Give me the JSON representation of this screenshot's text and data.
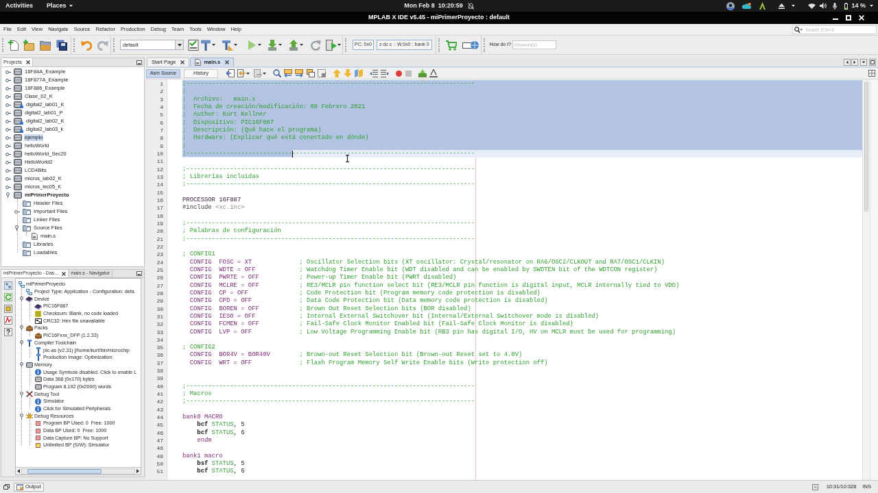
{
  "top_bar": {
    "activities": "Activities",
    "places": "Places",
    "clock": "Mon Feb 8  10:20:59",
    "battery": "14 %"
  },
  "window": {
    "title": "MPLAB X IDE v5.45 - miPrimerProyecto : default"
  },
  "menu": [
    "File",
    "Edit",
    "View",
    "Navigate",
    "Source",
    "Refactor",
    "Production",
    "Debug",
    "Team",
    "Tools",
    "Window",
    "Help"
  ],
  "search": {
    "placeholder": "Search (Ctrl+I)"
  },
  "toolbar": {
    "configuration": "default",
    "pc": "PC: 0x0",
    "registers": "z dc c  : W:0x0 : bank 0",
    "help_label": "How do I?",
    "keyword": {
      "placeholder": "Keyword(s)"
    }
  },
  "projects": {
    "title": "Projects",
    "items": [
      {
        "label": "16F84A_Example",
        "kind": "project",
        "badge": false,
        "main": false,
        "selected": false,
        "expanded": false
      },
      {
        "label": "16F877A_Example",
        "kind": "project",
        "badge": false,
        "main": false,
        "selected": false,
        "expanded": false
      },
      {
        "label": "16F886_Example",
        "kind": "project",
        "badge": false,
        "main": false,
        "selected": false,
        "expanded": false
      },
      {
        "label": "Clase_02_K",
        "kind": "project",
        "badge": false,
        "main": false,
        "selected": false,
        "expanded": false
      },
      {
        "label": "digital2_lab01_K",
        "kind": "project",
        "badge": true,
        "main": false,
        "selected": false,
        "expanded": false
      },
      {
        "label": "digital2_lab01_P",
        "kind": "project",
        "badge": false,
        "main": false,
        "selected": false,
        "expanded": false
      },
      {
        "label": "digital2_lab02_K",
        "kind": "project",
        "badge": true,
        "main": false,
        "selected": false,
        "expanded": false
      },
      {
        "label": "digital2_lab03_k",
        "kind": "project",
        "badge": true,
        "main": false,
        "selected": false,
        "expanded": false
      },
      {
        "label": "ejemplo",
        "kind": "project",
        "badge": false,
        "main": false,
        "selected": true,
        "expanded": false
      },
      {
        "label": "helloWorld",
        "kind": "project",
        "badge": false,
        "main": false,
        "selected": false,
        "expanded": false
      },
      {
        "label": "helloWorld_Sec20",
        "kind": "project",
        "badge": false,
        "main": false,
        "selected": false,
        "expanded": false
      },
      {
        "label": "HelloWorld2",
        "kind": "project",
        "badge": false,
        "main": false,
        "selected": false,
        "expanded": false
      },
      {
        "label": "LCD4Bits",
        "kind": "project",
        "badge": false,
        "main": false,
        "selected": false,
        "expanded": false
      },
      {
        "label": "micros_lab02_K",
        "kind": "project",
        "badge": false,
        "main": false,
        "selected": false,
        "expanded": false
      },
      {
        "label": "micros_lec05_K",
        "kind": "project",
        "badge": false,
        "main": false,
        "selected": false,
        "expanded": false
      },
      {
        "label": "miPrimerProyecto",
        "kind": "project",
        "badge": false,
        "main": true,
        "selected": false,
        "expanded": true,
        "children": [
          {
            "label": "Header Files",
            "kind": "folder"
          },
          {
            "label": "Important Files",
            "kind": "folder",
            "expanded": false
          },
          {
            "label": "Linker Files",
            "kind": "folder"
          },
          {
            "label": "Source Files",
            "kind": "folder",
            "expanded": true,
            "children": [
              {
                "label": "main.s",
                "kind": "file"
              }
            ]
          },
          {
            "label": "Libraries",
            "kind": "folder"
          },
          {
            "label": "Loadables",
            "kind": "folder"
          }
        ]
      }
    ]
  },
  "dashboard": {
    "tabs": [
      {
        "label": "miPrimerProyecto - Das...",
        "selected": true
      },
      {
        "label": "main.s - Navigator",
        "selected": false
      }
    ],
    "tree": {
      "label": "miPrimerProyecto",
      "kind": "project",
      "children": [
        {
          "label": "Project Type: Application - Configuration: defa",
          "kind": "settings"
        },
        {
          "label": "Device",
          "kind": "chip",
          "expanded": true,
          "children": [
            {
              "label": "PIC16F887",
              "kind": "chip"
            },
            {
              "label": "Checksum: Blank, no code loaded",
              "kind": "checksum"
            },
            {
              "label": "CRC32: Hex file unavailable",
              "kind": "crc"
            }
          ]
        },
        {
          "label": "Packs",
          "kind": "pack",
          "expanded": true,
          "children": [
            {
              "label": "PIC16Fxxx_DFP (1.2.33)",
              "kind": "pack"
            }
          ]
        },
        {
          "label": "Compiler Toolchain",
          "kind": "toolchain",
          "expanded": true,
          "children": [
            {
              "label": "pic-as (v2.31) [/home/kurt/bin/microchip",
              "kind": "toolchain"
            },
            {
              "label": "Production Image: Optimization:",
              "kind": "toolchain"
            }
          ]
        },
        {
          "label": "Memory",
          "kind": "memory",
          "expanded": true,
          "children": [
            {
              "label": "Usage Symbols disabled. Click to enable L",
              "kind": "info"
            },
            {
              "label": "Data 368 (0x170) bytes",
              "kind": "memory"
            },
            {
              "label": "Program 8,192 (0x2000) words",
              "kind": "memory"
            }
          ]
        },
        {
          "label": "Debug Tool",
          "kind": "debug-tool",
          "expanded": true,
          "children": [
            {
              "label": "Simulator",
              "kind": "info"
            },
            {
              "label": "Click for Simulated Peripherals",
              "kind": "info"
            }
          ]
        },
        {
          "label": "Debug Resources",
          "kind": "bug",
          "expanded": true,
          "children": [
            {
              "label": "Program BP Used: 0  Free: 1000",
              "kind": "square",
              "color": "#e89a9a"
            },
            {
              "label": "Data BP Used: 0  Free: 1000",
              "kind": "square",
              "color": "#e89a9a"
            },
            {
              "label": "Data Capture BP: No Support",
              "kind": "square",
              "color": "#e89a9a"
            },
            {
              "label": "Unlimited BP (S/W): Simulator",
              "kind": "square",
              "color": "#f0e050"
            }
          ]
        }
      ]
    }
  },
  "editor": {
    "tabs": [
      {
        "label": "Start Page",
        "kind": "page",
        "selected": false
      },
      {
        "label": "main.s",
        "kind": "file",
        "selected": true
      }
    ],
    "views": [
      {
        "label": "Asm Source",
        "selected": true
      },
      {
        "label": "History",
        "selected": false
      }
    ],
    "lines": [
      {
        "number": "1",
        "selected": true,
        "current": false,
        "tokens": [
          {
            "kind": "comment",
            "text": ";-------------------------------------------------------------------------------"
          }
        ]
      },
      {
        "number": "2",
        "selected": true,
        "current": false,
        "tokens": [
          {
            "kind": "comment",
            "text": ";"
          }
        ]
      },
      {
        "number": "3",
        "selected": true,
        "current": false,
        "tokens": [
          {
            "kind": "comment",
            "text": ";  Archivo:   main.s"
          }
        ]
      },
      {
        "number": "4",
        "selected": true,
        "current": false,
        "tokens": [
          {
            "kind": "comment",
            "text": ";  Fecha de creación/modificación: 08 Febrero 2021"
          }
        ]
      },
      {
        "number": "5",
        "selected": true,
        "current": false,
        "tokens": [
          {
            "kind": "comment",
            "text": ";  Author: Kurt Kellner"
          }
        ]
      },
      {
        "number": "6",
        "selected": true,
        "current": false,
        "tokens": [
          {
            "kind": "comment",
            "text": ";  Dispositivo: PIC16F887"
          }
        ]
      },
      {
        "number": "7",
        "selected": true,
        "current": false,
        "tokens": [
          {
            "kind": "comment",
            "text": ";  Descripción: (Qué hace el programa)"
          }
        ]
      },
      {
        "number": "8",
        "selected": true,
        "current": false,
        "tokens": [
          {
            "kind": "comment",
            "text": ";  Hardware: (Explicar qué está conectado en dónde)"
          }
        ]
      },
      {
        "number": "9",
        "selected": true,
        "current": false,
        "tokens": [
          {
            "kind": "comment",
            "text": ";"
          }
        ]
      },
      {
        "number": "10",
        "selected": false,
        "current": true,
        "tokens": [
          {
            "kind": "comment",
            "text": ";-----------------------------",
            "selected": true
          },
          {
            "kind": "comment",
            "text": "--------------------------------------------------",
            "selected": false
          }
        ]
      },
      {
        "number": "11",
        "selected": false,
        "current": false
      },
      {
        "number": "12",
        "selected": false,
        "current": false,
        "tokens": [
          {
            "kind": "comment",
            "text": ";-------------------------------------------------------------------------------"
          }
        ]
      },
      {
        "number": "13",
        "selected": false,
        "current": false,
        "tokens": [
          {
            "kind": "comment",
            "text": "; Librerías incluidas"
          }
        ]
      },
      {
        "number": "14",
        "selected": false,
        "current": false,
        "tokens": [
          {
            "kind": "comment",
            "text": ";-------------------------------------------------------------------------------"
          }
        ]
      },
      {
        "number": "15",
        "selected": false,
        "current": false
      },
      {
        "number": "16",
        "selected": false,
        "current": false,
        "tokens": [
          {
            "kind": "processor",
            "text": "PROCESSOR 16F887"
          }
        ]
      },
      {
        "number": "17",
        "selected": false,
        "current": false,
        "tokens": [
          {
            "kind": "preprocessor",
            "text": "#include "
          },
          {
            "kind": "string",
            "text": "<xc.inc>"
          }
        ]
      },
      {
        "number": "18",
        "selected": false,
        "current": false
      },
      {
        "number": "19",
        "selected": false,
        "current": false,
        "tokens": [
          {
            "kind": "comment",
            "text": ";-------------------------------------------------------------------------------"
          }
        ]
      },
      {
        "number": "20",
        "selected": false,
        "current": false,
        "tokens": [
          {
            "kind": "comment",
            "text": "; Palabras de configuración"
          }
        ]
      },
      {
        "number": "21",
        "selected": false,
        "current": false,
        "tokens": [
          {
            "kind": "comment",
            "text": ";-------------------------------------------------------------------------------"
          }
        ]
      },
      {
        "number": "22",
        "selected": false,
        "current": false
      },
      {
        "number": "23",
        "selected": false,
        "current": false,
        "tokens": [
          {
            "kind": "comment",
            "text": "; CONFIG1"
          }
        ]
      },
      {
        "number": "24",
        "selected": false,
        "current": false,
        "tokens": [
          {
            "kind": "directive",
            "text": "  CONFIG  FOSC = XT             "
          },
          {
            "kind": "comment",
            "text": "; Oscillator Selection bits (XT oscillator: Crystal/resonator on RA6/OSC2/CLKOUT and RA7/OSC1/CLKIN)"
          }
        ]
      },
      {
        "number": "25",
        "selected": false,
        "current": false,
        "tokens": [
          {
            "kind": "directive",
            "text": "  CONFIG  WDTE = OFF            "
          },
          {
            "kind": "comment",
            "text": "; Watchdog Timer Enable bit (WDT disabled and can be enabled by SWDTEN bit of the WDTCON register)"
          }
        ]
      },
      {
        "number": "26",
        "selected": false,
        "current": false,
        "tokens": [
          {
            "kind": "directive",
            "text": "  CONFIG  PWRTE = OFF           "
          },
          {
            "kind": "comment",
            "text": "; Power-up Timer Enable bit (PWRT disabled)"
          }
        ]
      },
      {
        "number": "27",
        "selected": false,
        "current": false,
        "tokens": [
          {
            "kind": "directive",
            "text": "  CONFIG  MCLRE = OFF           "
          },
          {
            "kind": "comment",
            "text": "; RE3/MCLR pin function select bit (RE3/MCLR pin function is digital input, MCLR internally tied to VDD)"
          }
        ]
      },
      {
        "number": "28",
        "selected": false,
        "current": false,
        "tokens": [
          {
            "kind": "directive",
            "text": "  CONFIG  CP = OFF              "
          },
          {
            "kind": "comment",
            "text": "; Code Protection bit (Program memory code protection is disabled)"
          }
        ]
      },
      {
        "number": "29",
        "selected": false,
        "current": false,
        "tokens": [
          {
            "kind": "directive",
            "text": "  CONFIG  CPD = OFF             "
          },
          {
            "kind": "comment",
            "text": "; Data Code Protection bit (Data memory code protection is disabled)"
          }
        ]
      },
      {
        "number": "30",
        "selected": false,
        "current": false,
        "tokens": [
          {
            "kind": "directive",
            "text": "  CONFIG  BOREN = OFF           "
          },
          {
            "kind": "comment",
            "text": "; Brown Out Reset Selection bits (BOR disabled)"
          }
        ]
      },
      {
        "number": "31",
        "selected": false,
        "current": false,
        "tokens": [
          {
            "kind": "directive",
            "text": "  CONFIG  IESO = OFF            "
          },
          {
            "kind": "comment",
            "text": "; Internal External Switchover bit (Internal/External Switchover mode is disabled)"
          }
        ]
      },
      {
        "number": "32",
        "selected": false,
        "current": false,
        "tokens": [
          {
            "kind": "directive",
            "text": "  CONFIG  FCMEN = OFF           "
          },
          {
            "kind": "comment",
            "text": "; Fail-Safe Clock Monitor Enabled bit (Fail-Safe Clock Monitor is disabled)"
          }
        ]
      },
      {
        "number": "33",
        "selected": false,
        "current": false,
        "tokens": [
          {
            "kind": "directive",
            "text": "  CONFIG  LVP = OFF             "
          },
          {
            "kind": "comment",
            "text": "; Low Voltage Programming Enable bit (RB3 pin has digital I/O, HV on MCLR must be used for programming)"
          }
        ]
      },
      {
        "number": "34",
        "selected": false,
        "current": false
      },
      {
        "number": "35",
        "selected": false,
        "current": false,
        "tokens": [
          {
            "kind": "comment",
            "text": "; CONFIG2"
          }
        ]
      },
      {
        "number": "36",
        "selected": false,
        "current": false,
        "tokens": [
          {
            "kind": "directive",
            "text": "  CONFIG  BOR4V = BOR40V        "
          },
          {
            "kind": "comment",
            "text": "; Brown-out Reset Selection bit (Brown-out Reset set to 4.0V)"
          }
        ]
      },
      {
        "number": "37",
        "selected": false,
        "current": false,
        "tokens": [
          {
            "kind": "directive",
            "text": "  CONFIG  WRT = OFF             "
          },
          {
            "kind": "comment",
            "text": "; Flash Program Memory Self Write Enable bits (Write protection off)"
          }
        ]
      },
      {
        "number": "38",
        "selected": false,
        "current": false
      },
      {
        "number": "39",
        "selected": false,
        "current": false
      },
      {
        "number": "40",
        "selected": false,
        "current": false,
        "tokens": [
          {
            "kind": "comment",
            "text": ";-------------------------------------------------------------------------------"
          }
        ]
      },
      {
        "number": "41",
        "selected": false,
        "current": false,
        "tokens": [
          {
            "kind": "comment",
            "text": "; Macros"
          }
        ]
      },
      {
        "number": "42",
        "selected": false,
        "current": false,
        "tokens": [
          {
            "kind": "comment",
            "text": ";-------------------------------------------------------------------------------"
          }
        ]
      },
      {
        "number": "43",
        "selected": false,
        "current": false
      },
      {
        "number": "44",
        "selected": false,
        "current": false,
        "tokens": [
          {
            "kind": "directive",
            "text": "bank0 MACRO"
          }
        ]
      },
      {
        "number": "45",
        "selected": false,
        "current": false,
        "tokens": [
          {
            "kind": "keyword",
            "text": "    bcf"
          },
          {
            "kind": "register",
            "text": " STATUS"
          },
          {
            "kind": "plain",
            "text": ", 5"
          }
        ]
      },
      {
        "number": "46",
        "selected": false,
        "current": false,
        "tokens": [
          {
            "kind": "keyword",
            "text": "    bcf"
          },
          {
            "kind": "register",
            "text": " STATUS"
          },
          {
            "kind": "plain",
            "text": ", 6"
          }
        ]
      },
      {
        "number": "47",
        "selected": false,
        "current": false,
        "tokens": [
          {
            "kind": "directive",
            "text": "    endm"
          }
        ]
      },
      {
        "number": "48",
        "selected": false,
        "current": false
      },
      {
        "number": "49",
        "selected": false,
        "current": false,
        "tokens": [
          {
            "kind": "directive",
            "text": "bank1 macro"
          }
        ]
      },
      {
        "number": "50",
        "selected": false,
        "current": false,
        "tokens": [
          {
            "kind": "keyword",
            "text": "    bsf"
          },
          {
            "kind": "register",
            "text": " STATUS"
          },
          {
            "kind": "plain",
            "text": ", 5"
          }
        ]
      },
      {
        "number": "51",
        "selected": false,
        "current": false,
        "tokens": [
          {
            "kind": "keyword",
            "text": "    bcf"
          },
          {
            "kind": "register",
            "text": " STATUS"
          },
          {
            "kind": "plain",
            "text": ", 6"
          }
        ]
      }
    ]
  },
  "status_bar": {
    "output": "Output",
    "position": "10:31/10:328",
    "mode": "INS"
  }
}
